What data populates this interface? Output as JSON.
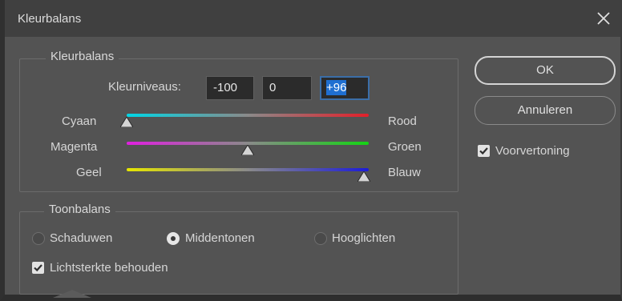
{
  "window": {
    "title": "Kleurbalans",
    "close_icon": "close-icon"
  },
  "color_balance": {
    "group_title": "Kleurbalans",
    "levels_label": "Kleurniveaus:",
    "levels": [
      "-100",
      "0",
      "+96"
    ],
    "sliders": [
      {
        "left_label": "Cyaan",
        "right_label": "Rood",
        "value": -100
      },
      {
        "left_label": "Magenta",
        "right_label": "Groen",
        "value": 0
      },
      {
        "left_label": "Geel",
        "right_label": "Blauw",
        "value": 96
      }
    ]
  },
  "tone_balance": {
    "group_title": "Toonbalans",
    "options": [
      {
        "label": "Schaduwen",
        "selected": false
      },
      {
        "label": "Middentonen",
        "selected": true
      },
      {
        "label": "Hooglichten",
        "selected": false
      }
    ],
    "preserve_luminosity_label": "Lichtsterkte behouden",
    "preserve_luminosity_checked": true
  },
  "buttons": {
    "ok_label": "OK",
    "cancel_label": "Annuleren"
  },
  "preview": {
    "label": "Voorvertoning",
    "checked": true
  },
  "colors": {
    "accent": "#1f6fd1",
    "panel": "#535353",
    "titlebar": "#404040"
  }
}
